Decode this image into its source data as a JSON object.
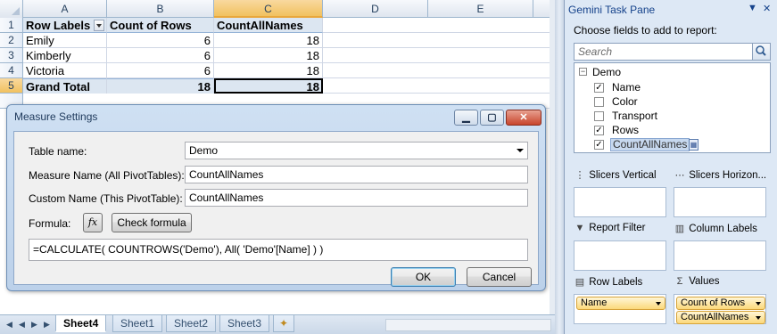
{
  "sheet": {
    "columns": [
      "A",
      "B",
      "C",
      "D",
      "E"
    ],
    "row_numbers": [
      "1",
      "2",
      "3",
      "4",
      "5"
    ],
    "header_row": {
      "a": "Row Labels",
      "b": "Count of Rows",
      "c": "CountAllNames"
    },
    "rows": [
      {
        "a": "Emily",
        "b": "6",
        "c": "18"
      },
      {
        "a": "Kimberly",
        "b": "6",
        "c": "18"
      },
      {
        "a": "Victoria",
        "b": "6",
        "c": "18"
      }
    ],
    "total_row": {
      "a": "Grand Total",
      "b": "18",
      "c": "18"
    },
    "tabs": [
      "Sheet4",
      "Sheet1",
      "Sheet2",
      "Sheet3"
    ]
  },
  "dialog": {
    "title": "Measure Settings",
    "table_name_label": "Table name:",
    "table_name_value": "Demo",
    "measure_name_label": "Measure Name (All PivotTables):",
    "measure_name_value": "CountAllNames",
    "custom_name_label": "Custom Name (This PivotTable):",
    "custom_name_value": "CountAllNames",
    "formula_label": "Formula:",
    "fx_label": "fx",
    "check_formula_label": "Check formula",
    "formula_value": "=CALCULATE( COUNTROWS('Demo'), All( 'Demo'[Name] ) )",
    "ok_label": "OK",
    "cancel_label": "Cancel"
  },
  "pane": {
    "title": "Gemini Task Pane",
    "subtitle": "Choose fields to add to report:",
    "search_placeholder": "Search",
    "table": "Demo",
    "fields": [
      {
        "name": "Name",
        "checked": true
      },
      {
        "name": "Color",
        "checked": false
      },
      {
        "name": "Transport",
        "checked": false
      },
      {
        "name": "Rows",
        "checked": true
      },
      {
        "name": "CountAllNames",
        "checked": true
      }
    ],
    "zones": {
      "slicers_vertical": "Slicers Vertical",
      "slicers_horizontal": "Slicers Horizon...",
      "report_filter": "Report Filter",
      "column_labels": "Column Labels",
      "row_labels": "Row Labels",
      "values": "Values"
    },
    "row_label_fields": [
      "Name"
    ],
    "value_fields": [
      "Count of Rows",
      "CountAllNames"
    ]
  }
}
